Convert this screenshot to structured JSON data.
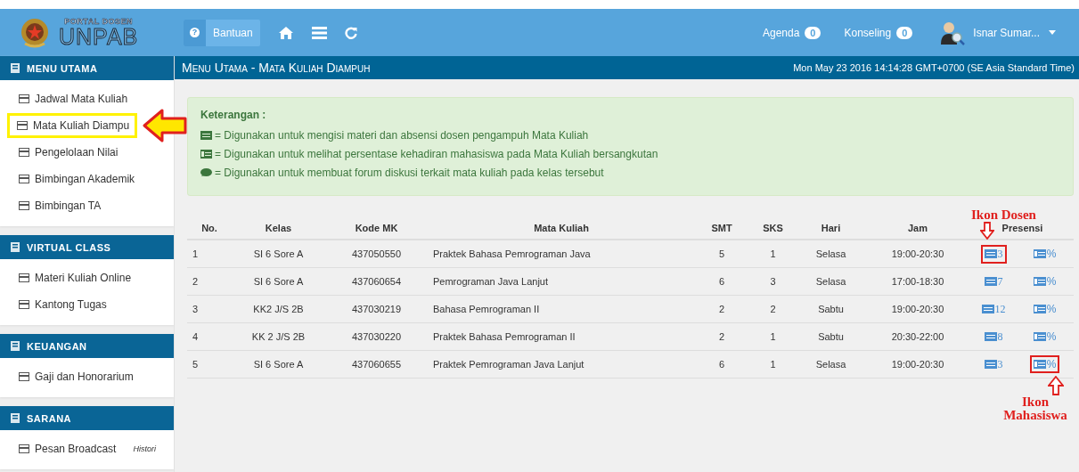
{
  "header": {
    "logo_top": "PORTAL DOSEN",
    "logo_main": "UNPAB",
    "help_icon": "?",
    "help_button": "Bantuan",
    "agenda": {
      "label": "Agenda",
      "count": "0"
    },
    "konseling": {
      "label": "Konseling",
      "count": "0"
    },
    "user_name": "Isnar Sumar..."
  },
  "sidebar": [
    {
      "title": "MENU UTAMA",
      "items": [
        {
          "label": "Jadwal Mata Kuliah",
          "highlighted": false
        },
        {
          "label": "Mata Kuliah Diampu",
          "highlighted": true
        },
        {
          "label": "Pengelolaan Nilai",
          "highlighted": false
        },
        {
          "label": "Bimbingan Akademik",
          "highlighted": false
        },
        {
          "label": "Bimbingan TA",
          "highlighted": false
        }
      ]
    },
    {
      "title": "VIRTUAL CLASS",
      "items": [
        {
          "label": "Materi Kuliah Online",
          "highlighted": false
        },
        {
          "label": "Kantong Tugas",
          "highlighted": false
        }
      ]
    },
    {
      "title": "KEUANGAN",
      "items": [
        {
          "label": "Gaji dan Honorarium",
          "highlighted": false
        }
      ]
    },
    {
      "title": "SARANA",
      "items": [
        {
          "label": "Pesan Broadcast",
          "note": "Histori",
          "highlighted": false
        }
      ]
    }
  ],
  "page_title": "Menu Utama - Mata Kuliah Diampuh",
  "datetime": "Mon May 23 2016 14:14:28 GMT+0700 (SE Asia Standard Time)",
  "info": {
    "title": "Keterangan :",
    "lines": [
      "= Digunakan untuk mengisi materi dan absensi dosen pengampuh Mata Kuliah",
      "= Digunakan untuk melihat persentase kehadiran mahasiswa pada Mata Kuliah bersangkutan",
      "= Digunakan untuk membuat forum diskusi terkait mata kuliah pada kelas tersebut"
    ]
  },
  "table": {
    "columns": [
      "No.",
      "Kelas",
      "Kode MK",
      "Mata Kuliah",
      "SMT",
      "SKS",
      "Hari",
      "Jam",
      "Presensi"
    ],
    "rows": [
      {
        "no": "1",
        "kelas": "SI 6 Sore A",
        "kode": "437050550",
        "mata_kuliah": "Praktek Bahasa Pemrograman Java",
        "smt": "5",
        "sks": "1",
        "hari": "Selasa",
        "jam": "19:00-20:30",
        "dosen_count": "3",
        "mahasiswa": "%",
        "dosen_highlighted": true,
        "mahasiswa_highlighted": false
      },
      {
        "no": "2",
        "kelas": "SI 6 Sore A",
        "kode": "437060654",
        "mata_kuliah": "Pemrograman Java Lanjut",
        "smt": "6",
        "sks": "3",
        "hari": "Selasa",
        "jam": "17:00-18:30",
        "dosen_count": "7",
        "mahasiswa": "%",
        "dosen_highlighted": false,
        "mahasiswa_highlighted": false
      },
      {
        "no": "3",
        "kelas": "KK2 J/S 2B",
        "kode": "437030219",
        "mata_kuliah": "Bahasa Pemrograman II",
        "smt": "2",
        "sks": "2",
        "hari": "Sabtu",
        "jam": "19:00-20:30",
        "dosen_count": "12",
        "mahasiswa": "%",
        "dosen_highlighted": false,
        "mahasiswa_highlighted": false
      },
      {
        "no": "4",
        "kelas": "KK 2 J/S 2B",
        "kode": "437030220",
        "mata_kuliah": "Praktek Bahasa Pemrograman II",
        "smt": "2",
        "sks": "1",
        "hari": "Sabtu",
        "jam": "20:30-22:00",
        "dosen_count": "8",
        "mahasiswa": "%",
        "dosen_highlighted": false,
        "mahasiswa_highlighted": false
      },
      {
        "no": "5",
        "kelas": "SI 6 Sore A",
        "kode": "437060655",
        "mata_kuliah": "Praktek Pemrograman Java Lanjut",
        "smt": "6",
        "sks": "1",
        "hari": "Selasa",
        "jam": "19:00-20:30",
        "dosen_count": "3",
        "mahasiswa": "%",
        "dosen_highlighted": false,
        "mahasiswa_highlighted": true
      }
    ]
  },
  "annotations": {
    "dosen_label": "Ikon Dosen",
    "mahasiswa_label": "Ikon Mahasiswa"
  }
}
